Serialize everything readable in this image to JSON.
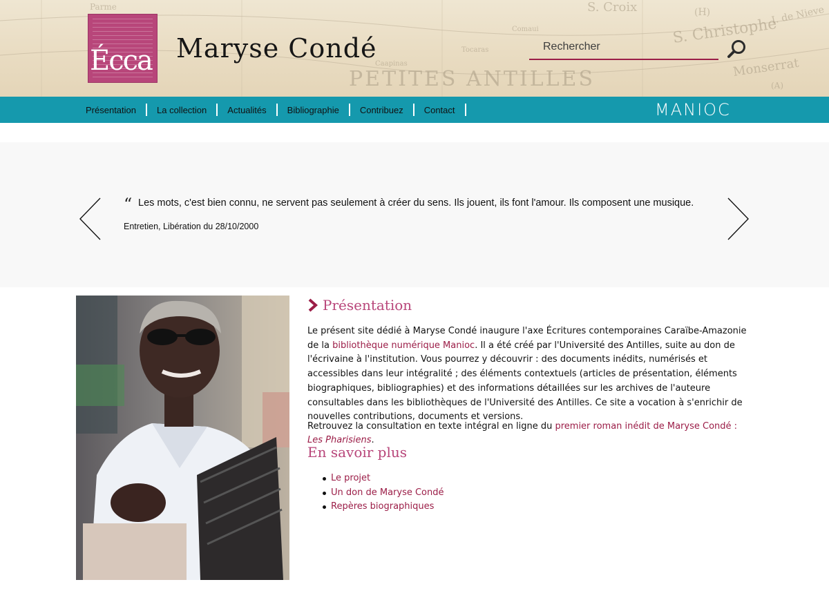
{
  "header": {
    "logo_text": "Écca",
    "site_title": "Maryse Condé",
    "search_placeholder": "Rechercher",
    "map_labels": [
      "Parme",
      "S. Croix",
      "S. Christophe",
      "PETITES ANTILLES",
      "Monserrat",
      "Tocaras",
      "Caapinas",
      "Comaui",
      "I. de Nieve",
      "(H)",
      "(A)"
    ]
  },
  "nav": {
    "items": [
      "Présentation",
      "La collection",
      "Actualités",
      "Bibliographie",
      "Contribuez",
      "Contact"
    ],
    "partner_logo": "MANIOC"
  },
  "quote": {
    "text": "Les mots, c'est bien connu, ne servent pas seulement à créer du sens. Ils jouent, ils font l'amour. Ils composent une musique.",
    "source": "Entretien, Libération du 28/10/2000"
  },
  "presentation": {
    "title": "Présentation",
    "p1_before": "Le présent site dédié à Maryse Condé inaugure l'axe Écritures contemporaines Caraïbe-Amazonie de la ",
    "p1_link": "bibliothèque numérique Manioc",
    "p1_after": ". Il a été créé par l'Université des Antilles, suite au don de l'écrivaine à l'institution. Vous pourrez y découvrir : des documents inédits, numérisés et accessibles dans leur intégralité ; des éléments contextuels (articles de présentation, éléments biographiques, bibliographies) et des informations détaillées sur les archives de l'auteure consultables dans les bibliothèques de l'Université des Antilles. Ce site a vocation à s'enrichir de nouvelles contributions, documents et versions.",
    "p2_before": "Retrouvez la consultation en texte intégral en ligne du ",
    "p2_link": "premier roman inédit de Maryse Condé : ",
    "p2_link_em": "Les Pharisiens",
    "p2_after": "."
  },
  "savoir": {
    "title": "En savoir plus",
    "links": [
      "Le projet",
      "Un don de Maryse Condé",
      "Repères biographiques"
    ]
  },
  "colors": {
    "accent": "#9b1d47",
    "heading": "#b8467a",
    "nav_bg": "#1599ad"
  },
  "icons": {
    "search": "magnifier-icon",
    "prev": "chevron-left-icon",
    "next": "chevron-right-icon"
  }
}
